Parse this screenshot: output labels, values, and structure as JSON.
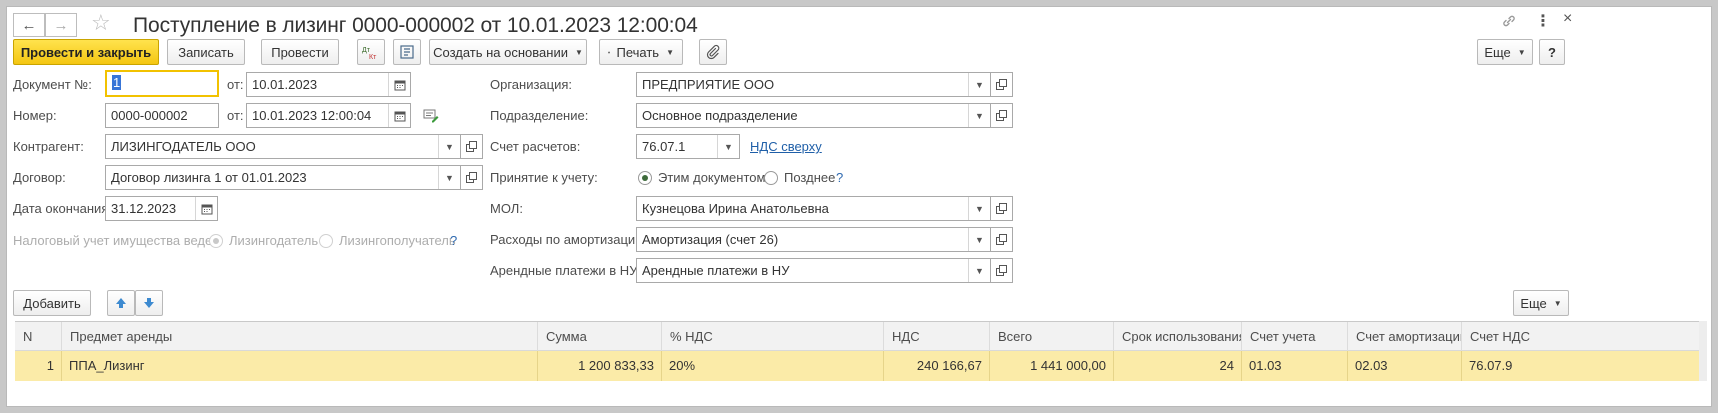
{
  "title": "Поступление в лизинг 0000-000002 от 10.01.2023 12:00:04",
  "toolbar": {
    "post_close": "Провести и закрыть",
    "save": "Записать",
    "post": "Провести",
    "create_basis": "Создать на основании",
    "print": "Печать",
    "more": "Еще"
  },
  "form": {
    "doc_no_label": "Документ №:",
    "doc_no_value": "1",
    "from_label": "от:",
    "doc_date": "10.01.2023",
    "number_label": "Номер:",
    "number_value": "0000-000002",
    "from_label2": "от:",
    "number_datetime": "10.01.2023 12:00:04",
    "counterparty_label": "Контрагент:",
    "counterparty_value": "ЛИЗИНГОДАТЕЛЬ ООО",
    "contract_label": "Договор:",
    "contract_value": "Договор лизинга 1 от 01.01.2023",
    "end_date_label": "Дата окончания:",
    "end_date_value": "31.12.2023",
    "tax_label": "Налоговый учет имущества ведет:",
    "tax_opt1": "Лизингодатель",
    "tax_opt2": "Лизингополучатель",
    "help": "?",
    "org_label": "Организация:",
    "org_value": "ПРЕДПРИЯТИЕ ООО",
    "dept_label": "Подразделение:",
    "dept_value": "Основное подразделение",
    "account_label": "Счет расчетов:",
    "account_value": "76.07.1",
    "vat_link": "НДС сверху",
    "accept_label": "Принятие к учету:",
    "accept_opt1": "Этим документом",
    "accept_opt2": "Позднее",
    "mol_label": "МОЛ:",
    "mol_value": "Кузнецова Ирина Анатольевна",
    "amort_label": "Расходы по амортизации:",
    "amort_value": "Амортизация (счет 26)",
    "lease_label": "Арендные платежи в НУ:",
    "lease_value": "Арендные платежи в НУ"
  },
  "table_toolbar": {
    "add": "Добавить",
    "more": "Еще"
  },
  "table": {
    "columns": [
      "N",
      "Предмет аренды",
      "Сумма",
      "% НДС",
      "НДС",
      "Всего",
      "Срок использования",
      "Счет учета",
      "Счет амортизации",
      "Счет НДС"
    ],
    "rows": [
      [
        "1",
        "ППА_Лизинг",
        "1 200 833,33",
        "20%",
        "240 166,67",
        "1 441 000,00",
        "24",
        "01.03",
        "02.03",
        "76.07.9"
      ]
    ]
  },
  "colors": {
    "primary_button": "#f4c612",
    "selected_row": "#fbeba8",
    "link": "#1f5fa8"
  }
}
